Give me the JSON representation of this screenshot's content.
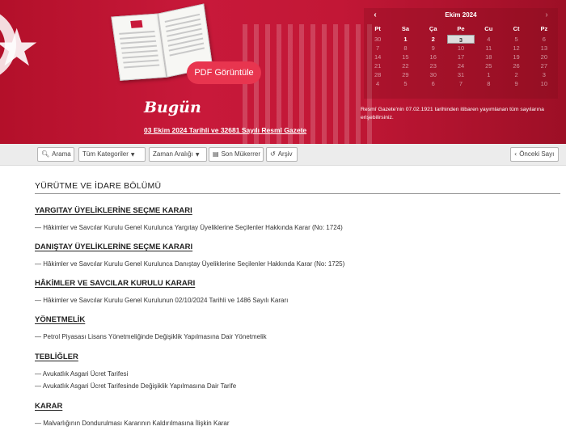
{
  "hero": {
    "pdf_button": "PDF Görüntüle",
    "today_label": "Bugün",
    "gazette_link": "03 Ekim 2024 Tarihli ve 32681 Sayılı Resmî Gazete",
    "calendar_note": "Resmî Gazete'nin 07.02.1921 tarihinden itibaren yayımlanan tüm sayılarına erişebilirsiniz."
  },
  "calendar": {
    "month_label": "Ekim 2024",
    "prev": "‹",
    "next": "›",
    "days": [
      "Pt",
      "Sa",
      "Ça",
      "Pe",
      "Cu",
      "Ct",
      "Pz"
    ],
    "weeks": [
      [
        "30",
        "1",
        "2",
        "3",
        "4",
        "5",
        "6"
      ],
      [
        "7",
        "8",
        "9",
        "10",
        "11",
        "12",
        "13"
      ],
      [
        "14",
        "15",
        "16",
        "17",
        "18",
        "19",
        "20"
      ],
      [
        "21",
        "22",
        "23",
        "24",
        "25",
        "26",
        "27"
      ],
      [
        "28",
        "29",
        "30",
        "31",
        "1",
        "2",
        "3"
      ],
      [
        "4",
        "5",
        "6",
        "7",
        "8",
        "9",
        "10"
      ]
    ],
    "selected": "3"
  },
  "toolbar": {
    "search": "Arama",
    "category": "Tüm Kategoriler",
    "date_range": "Zaman Aralığı",
    "last_repeated": "Son Mükerrer",
    "archive": "Arşiv",
    "prev_issue": "Önceki Sayı"
  },
  "content": {
    "section_title": "YÜRÜTME VE İDARE BÖLÜMÜ",
    "categories": [
      {
        "title": "YARGITAY ÜYELİKLERİNE SEÇME KARARI",
        "items": [
          "— Hâkimler ve Savcılar Kurulu Genel Kurulunca Yargıtay Üyeliklerine Seçilenler Hakkında Karar (No: 1724)"
        ]
      },
      {
        "title": "DANIŞTAY ÜYELİKLERİNE SEÇME KARARI",
        "items": [
          "— Hâkimler ve Savcılar Kurulu Genel Kurulunca Danıştay Üyeliklerine Seçilenler Hakkında Karar (No: 1725)"
        ]
      },
      {
        "title": "HÂKİMLER VE SAVCILAR KURULU KARARI",
        "items": [
          "— Hâkimler ve Savcılar Kurulu Genel Kurulunun 02/10/2024 Tarihli ve 1486 Sayılı Kararı"
        ]
      },
      {
        "title": "YÖNETMELİK",
        "items": [
          "— Petrol Piyasası Lisans Yönetmeliğinde Değişiklik Yapılmasına Dair Yönetmelik"
        ]
      },
      {
        "title": "TEBLİĞLER",
        "items": [
          "— Avukatlık Asgari Ücret Tarifesi",
          "— Avukatlık Asgari Ücret Tarifesinde Değişiklik Yapılmasına Dair Tarife"
        ]
      },
      {
        "title": "KARAR",
        "items": [
          "— Malvarlığının Dondurulması Kararının Kaldırılmasına İlişkin Karar"
        ]
      }
    ]
  }
}
